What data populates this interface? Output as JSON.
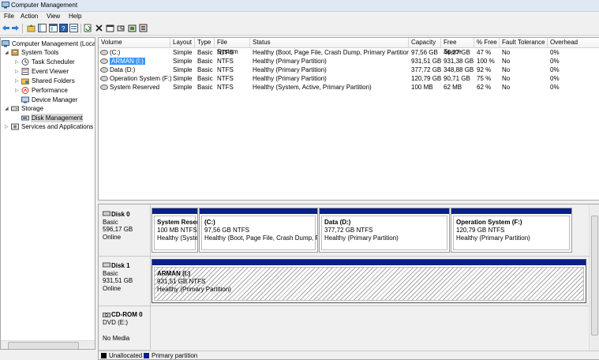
{
  "window": {
    "title": "Computer Management"
  },
  "menu": [
    "File",
    "Action",
    "View",
    "Help"
  ],
  "toolbar": {
    "icons": [
      "back-arrow-icon",
      "forward-arrow-icon",
      "up-folder-icon",
      "show-hide-tree-icon",
      "help-icon",
      "properties-icon",
      "refresh-icon",
      "delete-icon",
      "properties-page-icon",
      "disk-search-icon",
      "disk-settings-icon"
    ]
  },
  "tree": {
    "root": "Computer Management (Local",
    "system_tools": "System Tools",
    "task_scheduler": "Task Scheduler",
    "event_viewer": "Event Viewer",
    "shared_folders": "Shared Folders",
    "performance": "Performance",
    "device_manager": "Device Manager",
    "storage": "Storage",
    "disk_management": "Disk Management",
    "services": "Services and Applications"
  },
  "volumes": {
    "columns": [
      "Volume",
      "Layout",
      "Type",
      "File System",
      "Status",
      "Capacity",
      "Free Space",
      "% Free",
      "Fault Tolerance",
      "Overhead"
    ],
    "rows": [
      {
        "volume": "(C:)",
        "layout": "Simple",
        "type": "Basic",
        "fs": "NTFS",
        "status": "Healthy (Boot, Page File, Crash Dump, Primary Partition)",
        "capacity": "97,56 GB",
        "free": "46,27 GB",
        "pct": "47 %",
        "fault": "No",
        "overhead": "0%"
      },
      {
        "volume": "ARMAN (I:)",
        "layout": "Simple",
        "type": "Basic",
        "fs": "NTFS",
        "status": "Healthy (Primary Partition)",
        "capacity": "931,51 GB",
        "free": "931,38 GB",
        "pct": "100 %",
        "fault": "No",
        "overhead": "0%"
      },
      {
        "volume": "Data (D:)",
        "layout": "Simple",
        "type": "Basic",
        "fs": "NTFS",
        "status": "Healthy (Primary Partition)",
        "capacity": "377,72 GB",
        "free": "348,88 GB",
        "pct": "92 %",
        "fault": "No",
        "overhead": "0%"
      },
      {
        "volume": "Operation System (F:)",
        "layout": "Simple",
        "type": "Basic",
        "fs": "NTFS",
        "status": "Healthy (Primary Partition)",
        "capacity": "120,79 GB",
        "free": "90,71 GB",
        "pct": "75 %",
        "fault": "No",
        "overhead": "0%"
      },
      {
        "volume": "System Reserved",
        "layout": "Simple",
        "type": "Basic",
        "fs": "NTFS",
        "status": "Healthy (System, Active, Primary Partition)",
        "capacity": "100 MB",
        "free": "62 MB",
        "pct": "62 %",
        "fault": "No",
        "overhead": "0%"
      }
    ]
  },
  "disks": {
    "disk0": {
      "name": "Disk 0",
      "type": "Basic",
      "size": "596,17 GB",
      "state": "Online",
      "parts": [
        {
          "name": "System Reser",
          "size": "100 MB NTFS",
          "status": "Healthy (Syster"
        },
        {
          "name": "(C:)",
          "size": "97,56 GB NTFS",
          "status": "Healthy (Boot, Page File, Crash Dump, Pri"
        },
        {
          "name": "Data  (D:)",
          "size": "377,72 GB NTFS",
          "status": "Healthy (Primary Partition)"
        },
        {
          "name": "Operation System  (F:)",
          "size": "120,79 GB NTFS",
          "status": "Healthy (Primary Partition)"
        }
      ]
    },
    "disk1": {
      "name": "Disk 1",
      "type": "Basic",
      "size": "931,51 GB",
      "state": "Online",
      "part": {
        "name": "ARMAN  (I:)",
        "size": "931,51 GB NTFS",
        "status": "Healthy (Primary Partition)"
      }
    },
    "cdrom0": {
      "name": "CD-ROM 0",
      "type": "DVD (E:)",
      "state": "No Media"
    }
  },
  "legend": {
    "unallocated": "Unallocated",
    "primary": "Primary partition",
    "colors": {
      "unallocated": "#000000",
      "primary": "#0a1f8a"
    }
  }
}
